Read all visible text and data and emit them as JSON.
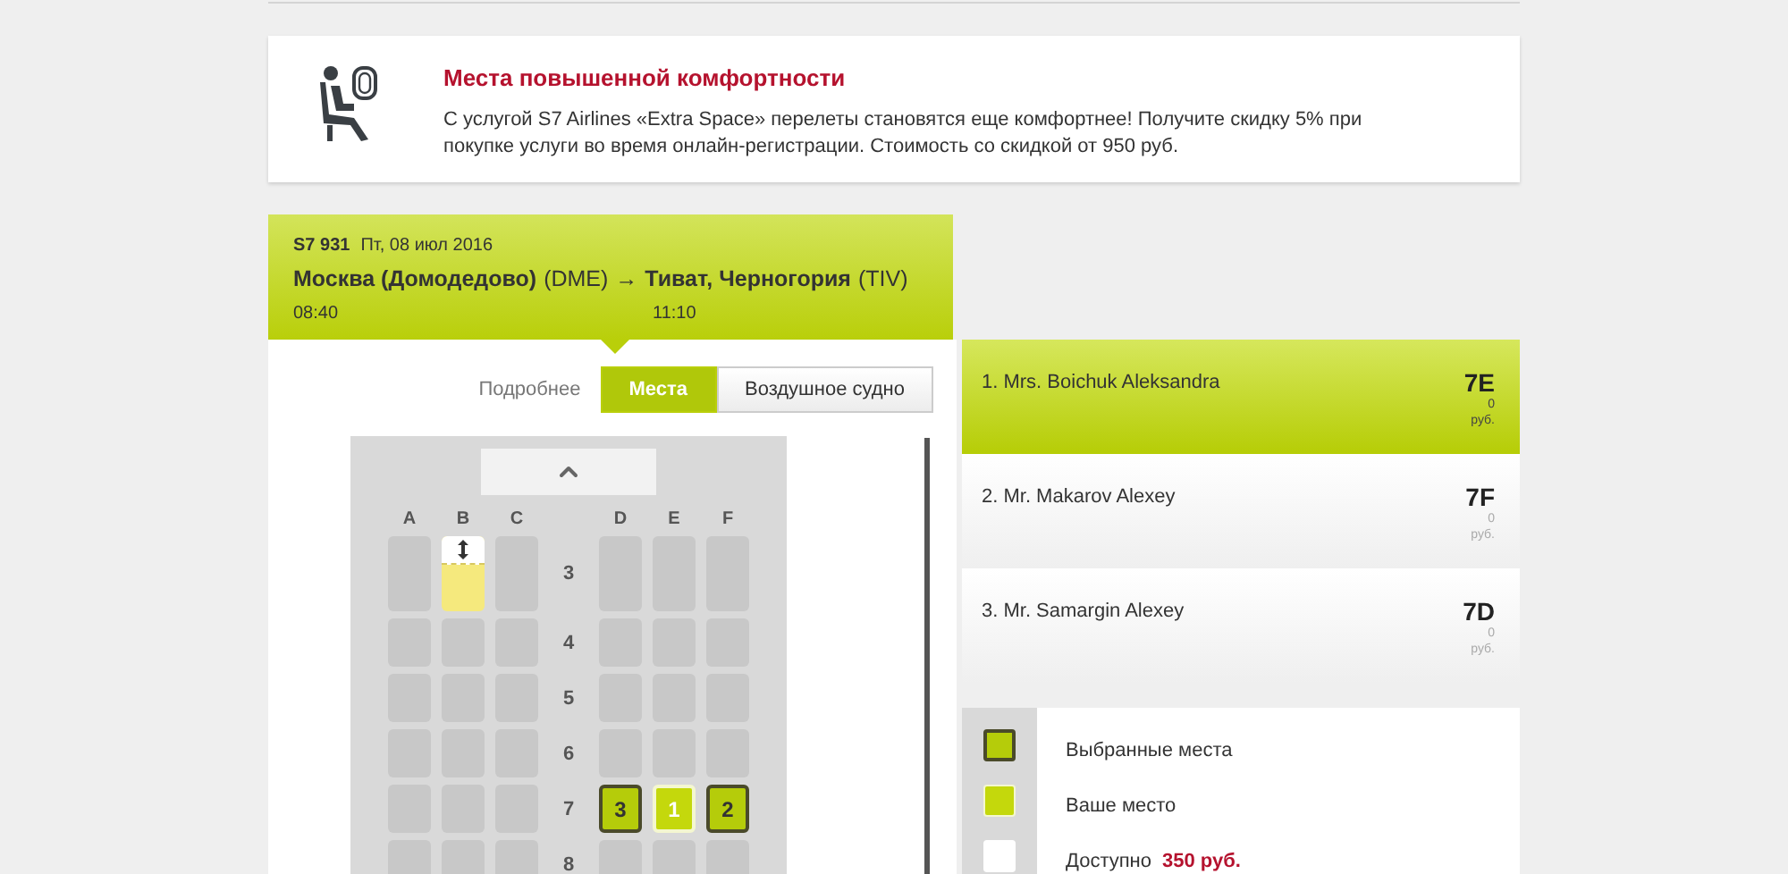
{
  "banner": {
    "title": "Места повышенной комфортности",
    "text": "С услугой S7 Airlines «Extra Space» перелеты становятся еще комфортнее! Получите скидку 5% при покупке услуги во время онлайн-регистрации. Стоимость со скидкой от 950 руб."
  },
  "flight": {
    "number": "S7 931",
    "date": "Пт, 08 июл 2016",
    "from_city": "Москва (Домодедово)",
    "from_code": "(DME)",
    "arrow": "→",
    "to_city": "Тиват, Черногория",
    "to_code": "(TIV)",
    "departure": "08:40",
    "arrival": "11:10"
  },
  "tabs": [
    {
      "label": "Подробнее",
      "selected": false,
      "kind": "link"
    },
    {
      "label": "Места",
      "selected": true,
      "kind": "button"
    },
    {
      "label": "Воздушное судно",
      "selected": false,
      "kind": "button"
    }
  ],
  "seat_map": {
    "columns_left": [
      "A",
      "B",
      "C"
    ],
    "columns_right": [
      "D",
      "E",
      "F"
    ],
    "rows": [
      {
        "number": "3",
        "seats": [
          {
            "kind": "occupied"
          },
          {
            "kind": "extra"
          },
          {
            "kind": "occupied"
          },
          {
            "kind": "occupied"
          },
          {
            "kind": "occupied"
          },
          {
            "kind": "occupied"
          }
        ]
      },
      {
        "number": "4",
        "seats": [
          {
            "kind": "occupied"
          },
          {
            "kind": "occupied"
          },
          {
            "kind": "occupied"
          },
          {
            "kind": "occupied"
          },
          {
            "kind": "occupied"
          },
          {
            "kind": "occupied"
          }
        ]
      },
      {
        "number": "5",
        "seats": [
          {
            "kind": "occupied"
          },
          {
            "kind": "occupied"
          },
          {
            "kind": "occupied"
          },
          {
            "kind": "occupied"
          },
          {
            "kind": "occupied"
          },
          {
            "kind": "occupied"
          }
        ]
      },
      {
        "number": "6",
        "seats": [
          {
            "kind": "occupied"
          },
          {
            "kind": "occupied"
          },
          {
            "kind": "occupied"
          },
          {
            "kind": "occupied"
          },
          {
            "kind": "occupied"
          },
          {
            "kind": "occupied"
          }
        ]
      },
      {
        "number": "7",
        "seats": [
          {
            "kind": "occupied"
          },
          {
            "kind": "occupied"
          },
          {
            "kind": "occupied"
          },
          {
            "kind": "selected",
            "label": "3"
          },
          {
            "kind": "current",
            "label": "1"
          },
          {
            "kind": "selected",
            "label": "2"
          }
        ]
      },
      {
        "number": "8",
        "seats": [
          {
            "kind": "occupied"
          },
          {
            "kind": "occupied"
          },
          {
            "kind": "occupied"
          },
          {
            "kind": "occupied"
          },
          {
            "kind": "occupied"
          },
          {
            "kind": "occupied"
          }
        ]
      }
    ]
  },
  "passengers": [
    {
      "name": "1. Mrs. Boichuk Aleksandra",
      "seat": "7E",
      "price": "0",
      "currency": "руб.",
      "selected": true
    },
    {
      "name": "2. Mr. Makarov Alexey",
      "seat": "7F",
      "price": "0",
      "currency": "руб.",
      "selected": false
    },
    {
      "name": "3. Mr. Samargin Alexey",
      "seat": "7D",
      "price": "0",
      "currency": "руб.",
      "selected": false
    }
  ],
  "legend": [
    {
      "kind": "selected",
      "label": "Выбранные места"
    },
    {
      "kind": "current",
      "label": "Ваше место"
    },
    {
      "kind": "available",
      "label": "Доступно",
      "price": "350 руб."
    }
  ]
}
